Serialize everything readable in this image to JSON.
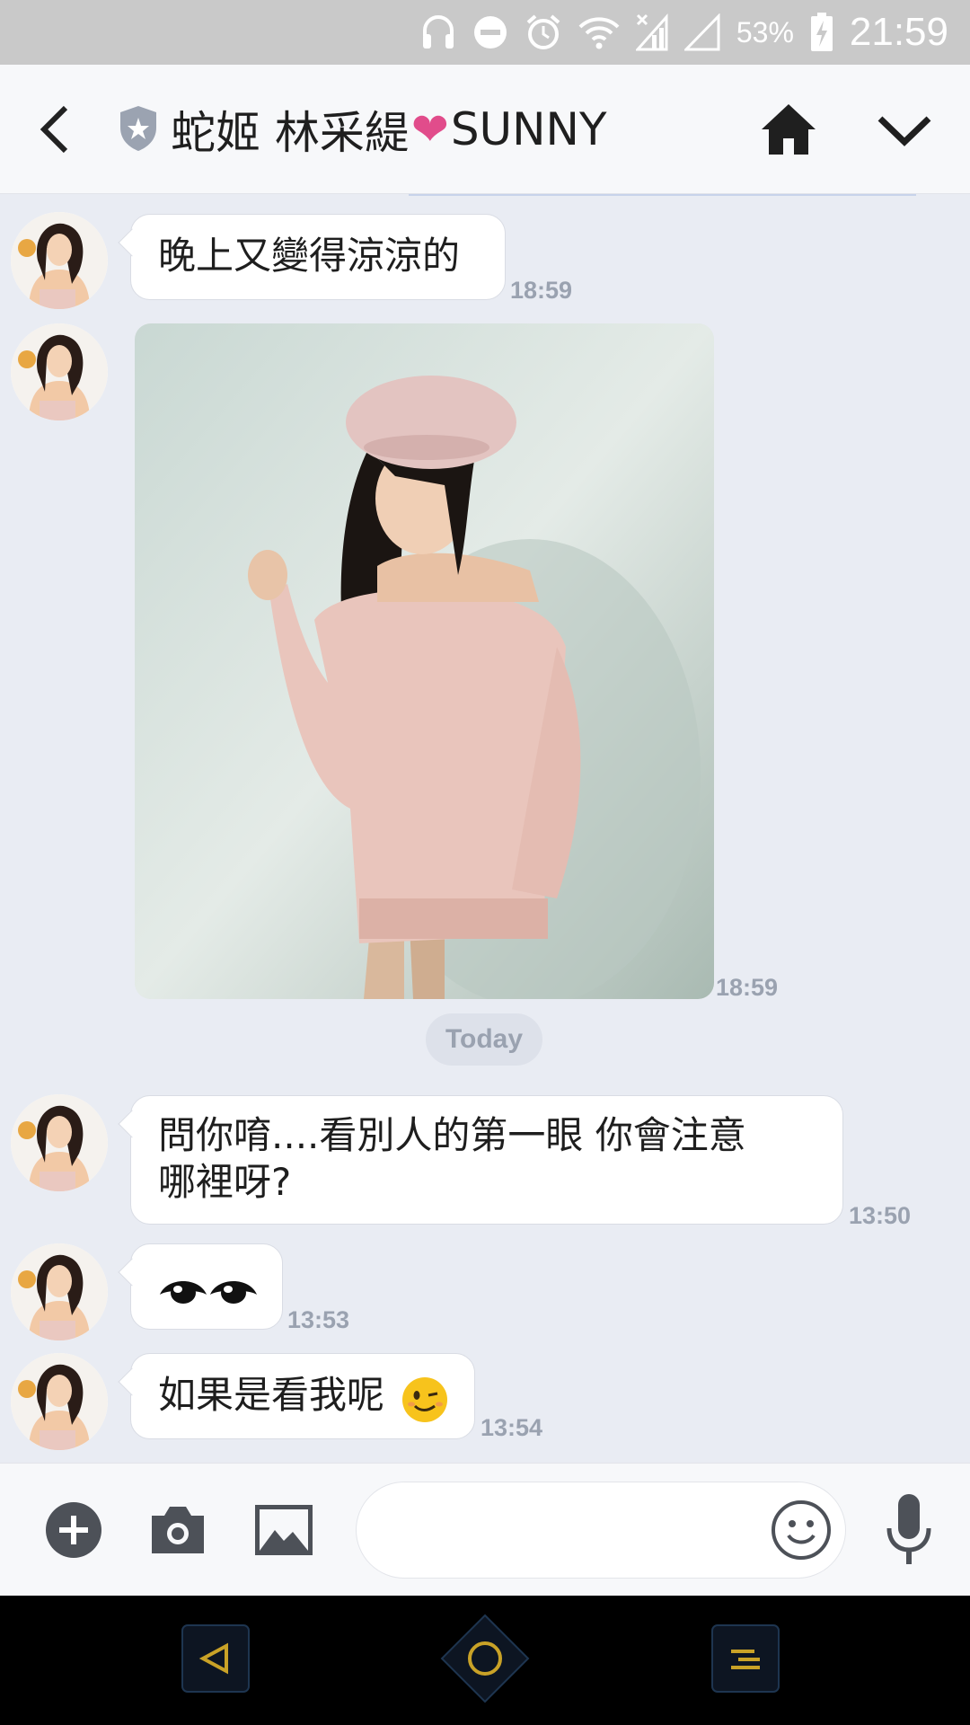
{
  "status_bar": {
    "battery_percent": "53%",
    "clock": "21:59",
    "icons": [
      "headphones-icon",
      "do-not-disturb-icon",
      "alarm-icon",
      "wifi-icon",
      "signal-off-icon",
      "signal-empty-icon",
      "battery-charging-icon"
    ]
  },
  "header": {
    "title_part1": "蛇姬 林采緹",
    "heart": "❤",
    "title_part2": "SUNNY",
    "icons": [
      "back-icon",
      "shield-star-icon",
      "home-icon",
      "chevron-down-icon"
    ]
  },
  "messages": [
    {
      "type": "text",
      "text": "晚上又變得涼涼的",
      "time": "18:59"
    },
    {
      "type": "image",
      "time": "18:59"
    },
    {
      "type": "date",
      "label": "Today"
    },
    {
      "type": "text",
      "text_line1": "問你唷....看別人的第一眼 你會注意",
      "text_line2": "哪裡呀?",
      "time": "13:50"
    },
    {
      "type": "emoji",
      "emoji": "eyes-emoji",
      "time": "13:53"
    },
    {
      "type": "text",
      "text": "如果是看我呢",
      "emoji": "wink-emoji",
      "time": "13:54"
    }
  ],
  "input_bar": {
    "placeholder": "",
    "icons": [
      "plus-icon",
      "camera-icon",
      "gallery-icon",
      "smiley-icon",
      "microphone-icon"
    ]
  },
  "nav_bar": {
    "icons": [
      "nav-back-icon",
      "nav-home-icon",
      "nav-recents-icon"
    ],
    "accent": "#c9a227"
  }
}
